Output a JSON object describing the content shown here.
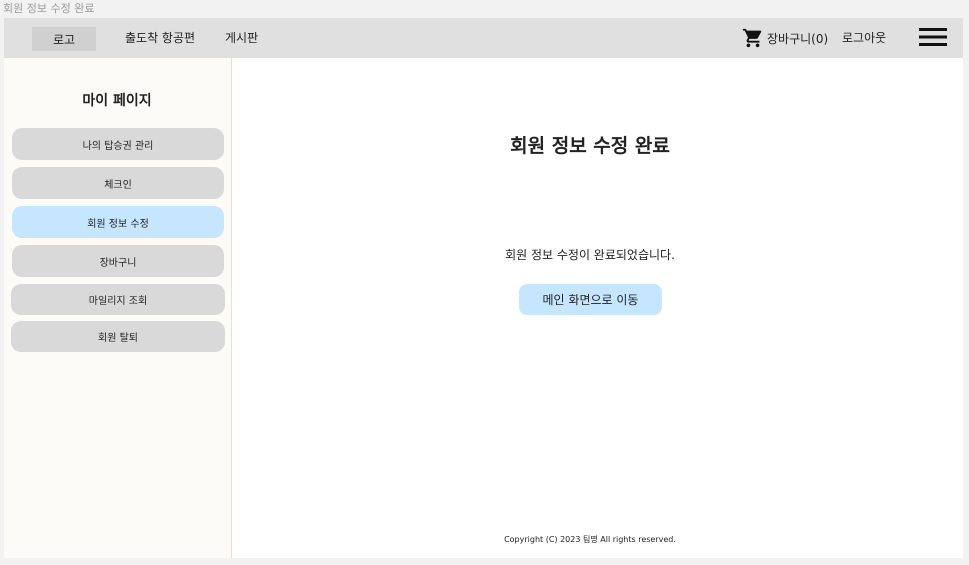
{
  "document_title": "회원 정보 수정 완료",
  "header": {
    "logo_label": "로고",
    "nav": {
      "flights": "출도착 항공편",
      "board": "게시판"
    },
    "cart_label": "장바구니(0)",
    "logout_label": "로그아웃",
    "icons": {
      "cart": "shopping-cart-icon",
      "menu": "hamburger-menu-icon"
    }
  },
  "sidebar": {
    "title": "마이 페이지",
    "items": [
      {
        "label": "나의 탑승권 관리",
        "active": false
      },
      {
        "label": "체크인",
        "active": false
      },
      {
        "label": "회원 정보 수정",
        "active": true
      },
      {
        "label": "장바구니",
        "active": false
      },
      {
        "label": "마일리지 조회",
        "active": false
      },
      {
        "label": "회원 탈퇴",
        "active": false
      }
    ]
  },
  "main": {
    "title": "회원 정보 수정 완료",
    "message": "회원 정보 수정이 완료되었습니다.",
    "home_button": "메인 화면으로 이동"
  },
  "footer": {
    "copyright": "Copyright (C) 2023 팀명 All rights reserved."
  },
  "colors": {
    "active_button": "#c6e6ff",
    "inactive_button": "#d9d9d9",
    "header_bg": "#e0e0e0",
    "sidebar_bg": "#fdfbf8"
  }
}
